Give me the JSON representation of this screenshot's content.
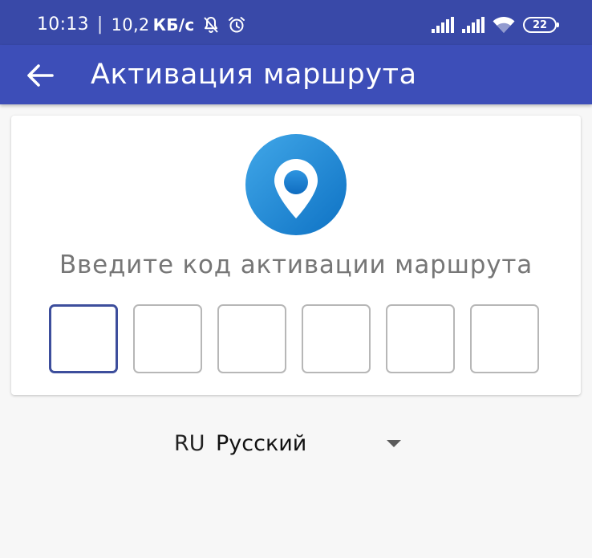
{
  "status_bar": {
    "time": "10:13",
    "separator": "|",
    "speed_value": "10,2",
    "speed_unit": "КБ/с",
    "battery": "22",
    "icons": [
      "notifications-muted-icon",
      "alarm-icon",
      "signal-icon",
      "signal-icon",
      "wifi-icon",
      "battery-icon"
    ]
  },
  "app_bar": {
    "title": "Активация маршрута",
    "back_icon": "arrow-back-icon"
  },
  "activation": {
    "logo_icon": "map-pin-logo-icon",
    "prompt": "Введите код активации маршрута",
    "code_boxes": [
      "",
      "",
      "",
      "",
      "",
      ""
    ],
    "active_box_index": 0
  },
  "language": {
    "code": "RU",
    "name": "Русский",
    "dropdown_icon": "dropdown-arrow-icon"
  },
  "colors": {
    "status_bar": "#3949a8",
    "app_bar": "#3d4eb8",
    "active_box_border": "#3d4e9c",
    "box_border": "#b7b7b7",
    "background": "#f7f7f7"
  }
}
